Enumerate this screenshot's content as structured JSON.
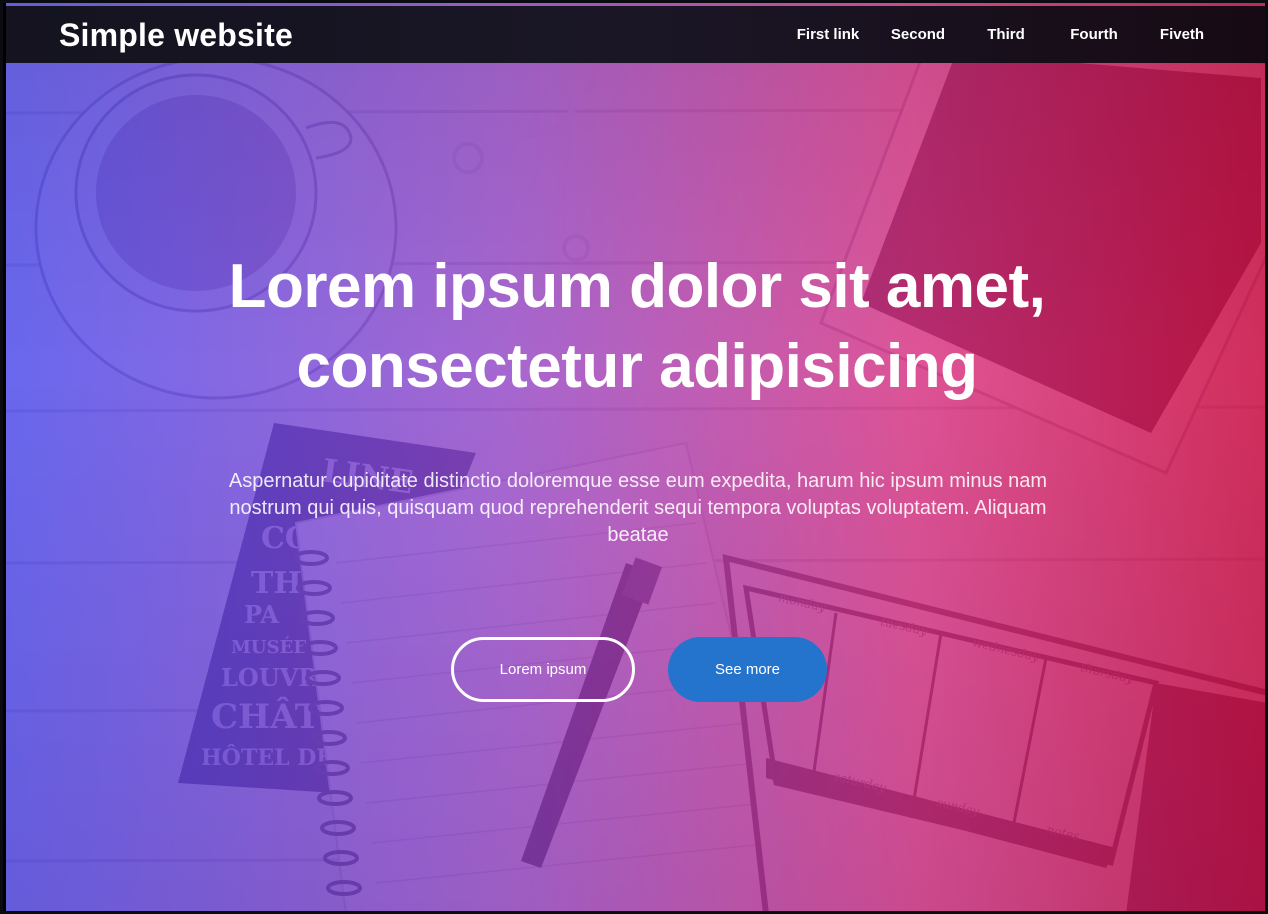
{
  "header": {
    "brand": "Simple website",
    "nav": [
      {
        "label": "First link"
      },
      {
        "label": "Second"
      },
      {
        "label": "Third"
      },
      {
        "label": "Fourth"
      },
      {
        "label": "Fiveth"
      }
    ]
  },
  "hero": {
    "headline_line1": "Lorem ipsum dolor sit amet,",
    "headline_line2": "consectetur adipisicing",
    "lead": "Aspernatur cupiditate distinctio doloremque esse eum expedita, harum hic ipsum minus nam nostrum qui quis, quisquam quod reprehenderit sequi tempora voluptas voluptatem. Aliquam beatae",
    "buttons": {
      "primary_outline": "Lorem ipsum",
      "see_more": "See more"
    },
    "background_image_subject": "desk with coffee cup, earphones, tablet, notebooks and pen",
    "background_image_text": [
      "LINE",
      "CO",
      "TH",
      "PA",
      "MUSÉE D",
      "LOUVR",
      "CHÂTE",
      "HÔTEL DE V",
      "monday",
      "tuesday",
      "wednesday",
      "thursday",
      "saturday",
      "sunday",
      "notes"
    ]
  },
  "colors": {
    "overlay_left": "#4d4bee",
    "overlay_right": "#cd1446",
    "navbar": "#14131f",
    "button_blue": "#2473cc"
  }
}
